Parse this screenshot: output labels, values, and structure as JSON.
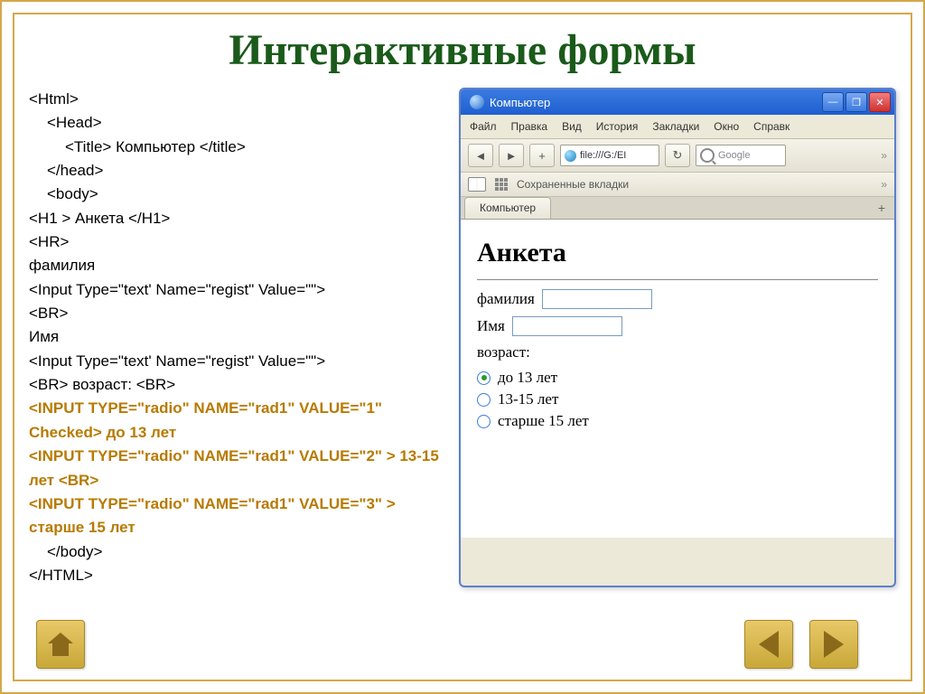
{
  "title": "Интерактивные формы",
  "code": {
    "lines": [
      {
        "t": "<Html>",
        "cls": "l0"
      },
      {
        "t": "<Head>",
        "cls": "l1"
      },
      {
        "t": "<Title> Компьютер </title>",
        "cls": "l2"
      },
      {
        "t": "</head>",
        "cls": "l1"
      },
      {
        "t": "<body>",
        "cls": "l1"
      },
      {
        "t": "<H1 > Анкета </H1>",
        "cls": "l0"
      },
      {
        "t": "<HR>",
        "cls": "l0"
      },
      {
        "t": "фамилия",
        "cls": "l0"
      },
      {
        "t": "<Input Type=\"text' Name=\"regist\" Value=\"\">",
        "cls": "l0"
      },
      {
        "t": "<BR>",
        "cls": "l0"
      },
      {
        "t": "Имя",
        "cls": "l0"
      },
      {
        "t": "<Input Type=\"text' Name=\"regist\" Value=\"\">",
        "cls": "l0"
      },
      {
        "t": "<BR> возраст: <BR>",
        "cls": "l0"
      },
      {
        "t": "<INPUT TYPE=\"radio\" NAME=\"rad1\" VALUE=\"1\" Checked> до 13 лет",
        "cls": "l0 hl"
      },
      {
        "t": "<INPUT TYPE=\"radio\" NAME=\"rad1\" VALUE=\"2\" > 13-15 лет <BR>",
        "cls": "l0 hl"
      },
      {
        "t": "<INPUT TYPE=\"radio\" NAME=\"rad1\" VALUE=\"3\" > старше 15 лет",
        "cls": "l0 hl"
      },
      {
        "t": "</body>",
        "cls": "l1"
      },
      {
        "t": "</HTML>",
        "cls": "l0"
      }
    ]
  },
  "browser": {
    "window_title": "Компьютер",
    "menu": [
      "Файл",
      "Правка",
      "Вид",
      "История",
      "Закладки",
      "Окно",
      "Справк"
    ],
    "url": "file:///G:/EI",
    "search_placeholder": "Google",
    "saved_bookmarks": "Сохраненные вкладки",
    "tab": "Компьютер",
    "page": {
      "heading": "Анкета",
      "surname_label": "фамилия",
      "name_label": "Имя",
      "age_label": "возраст:",
      "radios": [
        {
          "label": "до 13 лет",
          "checked": true
        },
        {
          "label": "13-15 лет",
          "checked": false
        },
        {
          "label": "старше 15 лет",
          "checked": false
        }
      ]
    }
  }
}
